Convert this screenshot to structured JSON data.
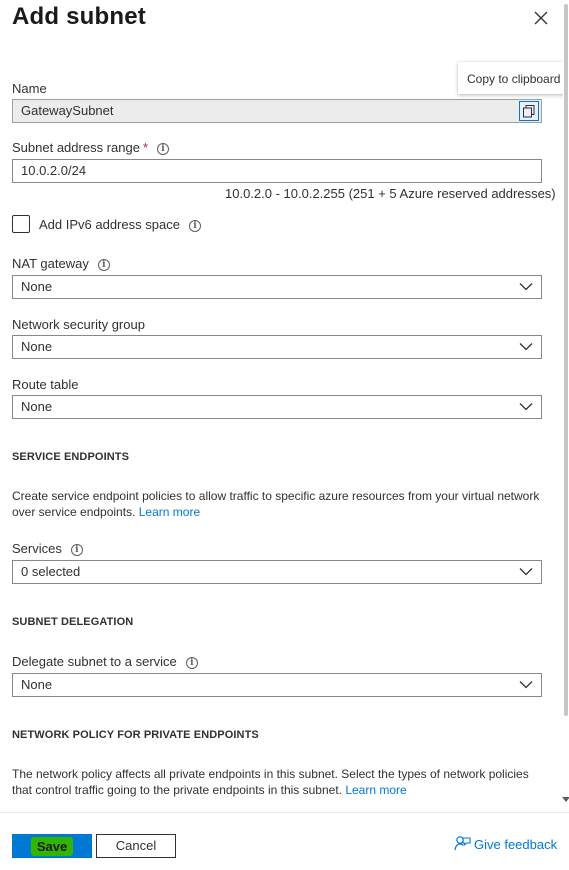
{
  "panel": {
    "title": "Add subnet"
  },
  "tooltip": {
    "text": "Copy to clipboard"
  },
  "name_field": {
    "label": "Name",
    "value": "GatewaySubnet"
  },
  "address_range": {
    "label": "Subnet address range",
    "required_mark": "*",
    "value": "10.0.2.0/24",
    "hint": "10.0.2.0 - 10.0.2.255 (251 + 5 Azure reserved addresses)"
  },
  "ipv6": {
    "label": "Add IPv6 address space",
    "checked": false
  },
  "nat_gateway": {
    "label": "NAT gateway",
    "value": "None"
  },
  "nsg": {
    "label": "Network security group",
    "value": "None"
  },
  "route_table": {
    "label": "Route table",
    "value": "None"
  },
  "service_endpoints": {
    "heading": "SERVICE ENDPOINTS",
    "description": "Create service endpoint policies to allow traffic to specific azure resources from your virtual network",
    "description_line2": "over service endpoints.",
    "learn_more": "Learn more",
    "services_label": "Services",
    "services_value": "0 selected"
  },
  "subnet_delegation": {
    "heading": "SUBNET DELEGATION",
    "label": "Delegate subnet to a service",
    "value": "None"
  },
  "network_policy": {
    "heading": "NETWORK POLICY FOR PRIVATE ENDPOINTS",
    "description": "The network policy affects all private endpoints in this subnet. Select the types of network policies",
    "description_line2": "that control traffic going to the private endpoints in this subnet.",
    "learn_more": "Learn more"
  },
  "footer": {
    "save_label": "Save",
    "cancel_label": "Cancel",
    "feedback_label": "Give feedback"
  },
  "icons": {
    "info": "info-icon",
    "chevron": "chevron-down-icon",
    "close": "close-icon",
    "copy": "copy-icon",
    "feedback": "feedback-person-icon"
  },
  "colors": {
    "accent": "#0078d4",
    "save_highlight": "#32b400",
    "required": "#a4262c"
  }
}
